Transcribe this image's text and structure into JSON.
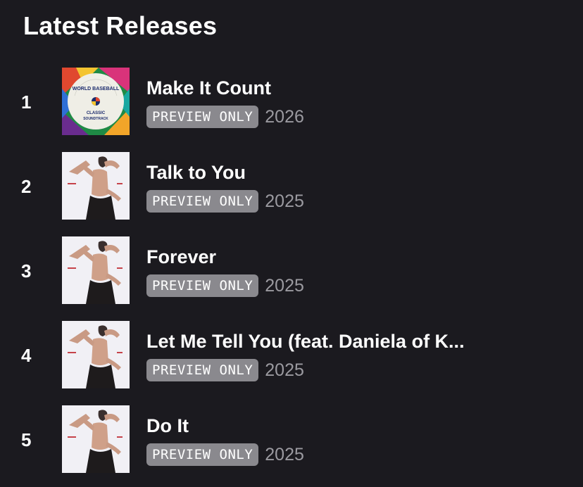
{
  "section": {
    "title": "Latest Releases"
  },
  "tracks": [
    {
      "index": "1",
      "title": "Make It Count",
      "badge": "PREVIEW ONLY",
      "year": "2026",
      "artwork": "world-baseball-classic-soundtrack-cover",
      "artwork_text": [
        "WORLD BASEBALL",
        "CLASSIC",
        "SOUNDTRACK"
      ]
    },
    {
      "index": "2",
      "title": "Talk to You",
      "badge": "PREVIEW ONLY",
      "year": "2025",
      "artwork": "portrait-album-cover"
    },
    {
      "index": "3",
      "title": "Forever",
      "badge": "PREVIEW ONLY",
      "year": "2025",
      "artwork": "portrait-album-cover"
    },
    {
      "index": "4",
      "title": "Let Me Tell You (feat. Daniela of K...",
      "badge": "PREVIEW ONLY",
      "year": "2025",
      "artwork": "portrait-album-cover"
    },
    {
      "index": "5",
      "title": "Do It",
      "badge": "PREVIEW ONLY",
      "year": "2025",
      "artwork": "portrait-album-cover"
    }
  ],
  "colors": {
    "background": "#1b1a1f",
    "badge": "#8a898e",
    "year_text": "#9b9aa0"
  }
}
